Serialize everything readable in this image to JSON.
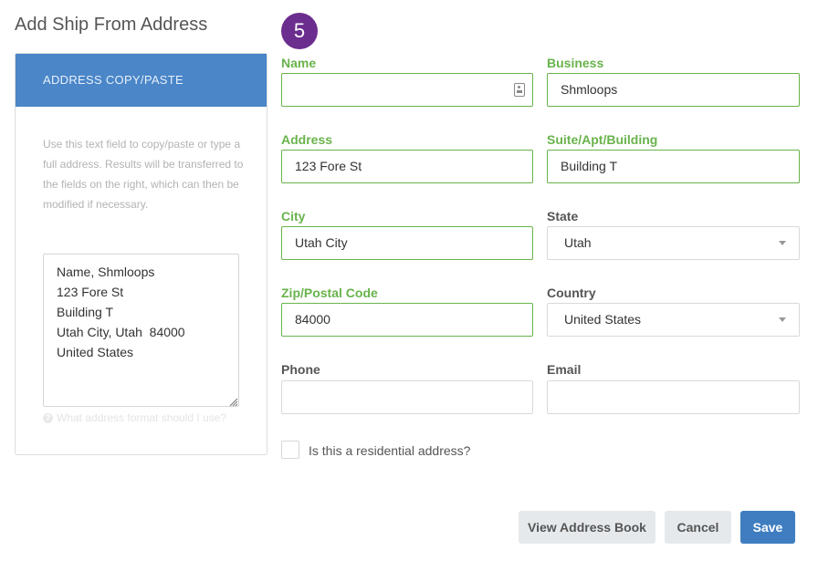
{
  "page": {
    "title": "Add Ship From Address",
    "step": "5"
  },
  "paste_panel": {
    "header": "ADDRESS COPY/PASTE",
    "help_text": "Use this text field to copy/paste or type a full address. Results will be transferred to the fields on the right, which can then be modified if necessary.",
    "textarea_value": "Name, Shmloops\n123 Fore St\nBuilding T\nUtah City, Utah  84000\nUnited States",
    "format_help": "What address format should I use?"
  },
  "form": {
    "name": {
      "label": "Name",
      "value": ""
    },
    "business": {
      "label": "Business",
      "value": "Shmloops"
    },
    "address": {
      "label": "Address",
      "value": "123 Fore St"
    },
    "suite": {
      "label": "Suite/Apt/Building",
      "value": "Building T"
    },
    "city": {
      "label": "City",
      "value": "Utah City"
    },
    "state": {
      "label": "State",
      "value": "Utah"
    },
    "zip": {
      "label": "Zip/Postal Code",
      "value": "84000"
    },
    "country": {
      "label": "Country",
      "value": "United States"
    },
    "phone": {
      "label": "Phone",
      "value": ""
    },
    "email": {
      "label": "Email",
      "value": ""
    },
    "residential": {
      "label": "Is this a residential address?",
      "checked": false
    }
  },
  "buttons": {
    "view_address_book": "View Address Book",
    "cancel": "Cancel",
    "save": "Save"
  },
  "colors": {
    "valid_green": "#69b34c",
    "panel_blue": "#4a86c8",
    "step_purple": "#6b2d8e",
    "primary_button": "#3f7dc0"
  },
  "icons": {
    "name_field": "contact-card-icon",
    "dropdown": "caret-down-icon",
    "help": "question-circle-icon"
  }
}
